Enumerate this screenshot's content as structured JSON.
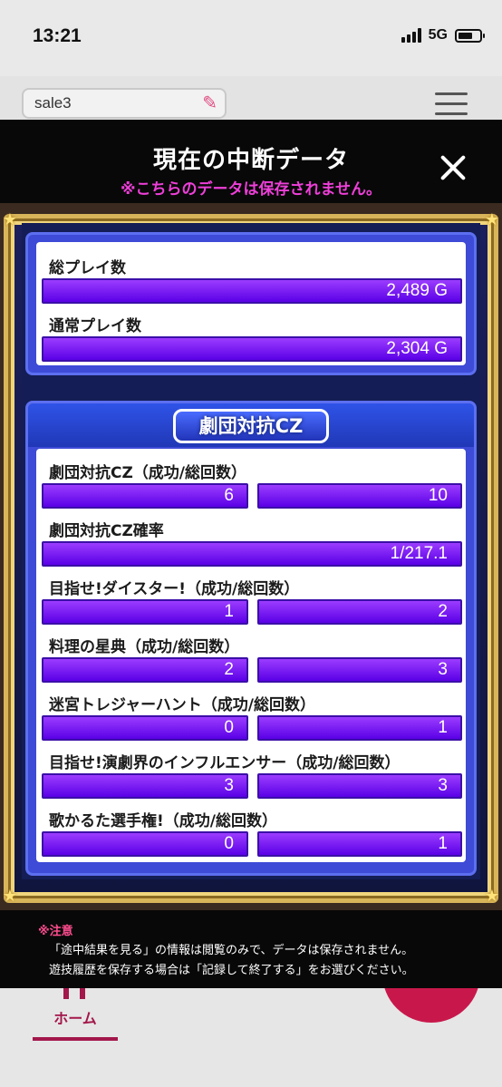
{
  "status_bar": {
    "time": "13:21",
    "network": "5G"
  },
  "header": {
    "search_value": "sale3",
    "icons": [
      "pencil-icon",
      "hamburger-menu-icon"
    ]
  },
  "modal": {
    "title": "現在の中断データ",
    "subtitle": "※こちらのデータは保存されません。",
    "close_icon": "close-icon",
    "frame_color": "#d9b55a",
    "subtitle_color": "#ee3fd9",
    "bar_color": "#7a1bff"
  },
  "summary": {
    "rows": [
      {
        "label": "総プレイ数",
        "value": "2,489 G"
      },
      {
        "label": "通常プレイ数",
        "value": "2,304 G"
      }
    ]
  },
  "cz_section": {
    "title": "劇団対抗CZ",
    "cz_label": "劇団対抗CZ（成功/総回数）",
    "cz_success": "6",
    "cz_total": "10",
    "rate_label": "劇団対抗CZ確率",
    "rate_value": "1/217.1",
    "items": [
      {
        "label": "目指せ!ダイスター!（成功/総回数）",
        "success": "1",
        "total": "2"
      },
      {
        "label": "料理の星典（成功/総回数）",
        "success": "2",
        "total": "3"
      },
      {
        "label": "迷宮トレジャーハント（成功/総回数）",
        "success": "0",
        "total": "1"
      },
      {
        "label": "目指せ!演劇界のインフルエンサー（成功/総回数）",
        "success": "3",
        "total": "3"
      },
      {
        "label": "歌かるた選手権!（成功/総回数）",
        "success": "0",
        "total": "1"
      }
    ]
  },
  "notice": {
    "title": "※注意",
    "line1": "「途中結果を見る」の情報は閲覧のみで、データは保存されません。",
    "line2": "遊技履歴を保存する場合は「記録して終了する」をお選びください。"
  },
  "bottom_nav": {
    "home_label": "ホーム"
  }
}
